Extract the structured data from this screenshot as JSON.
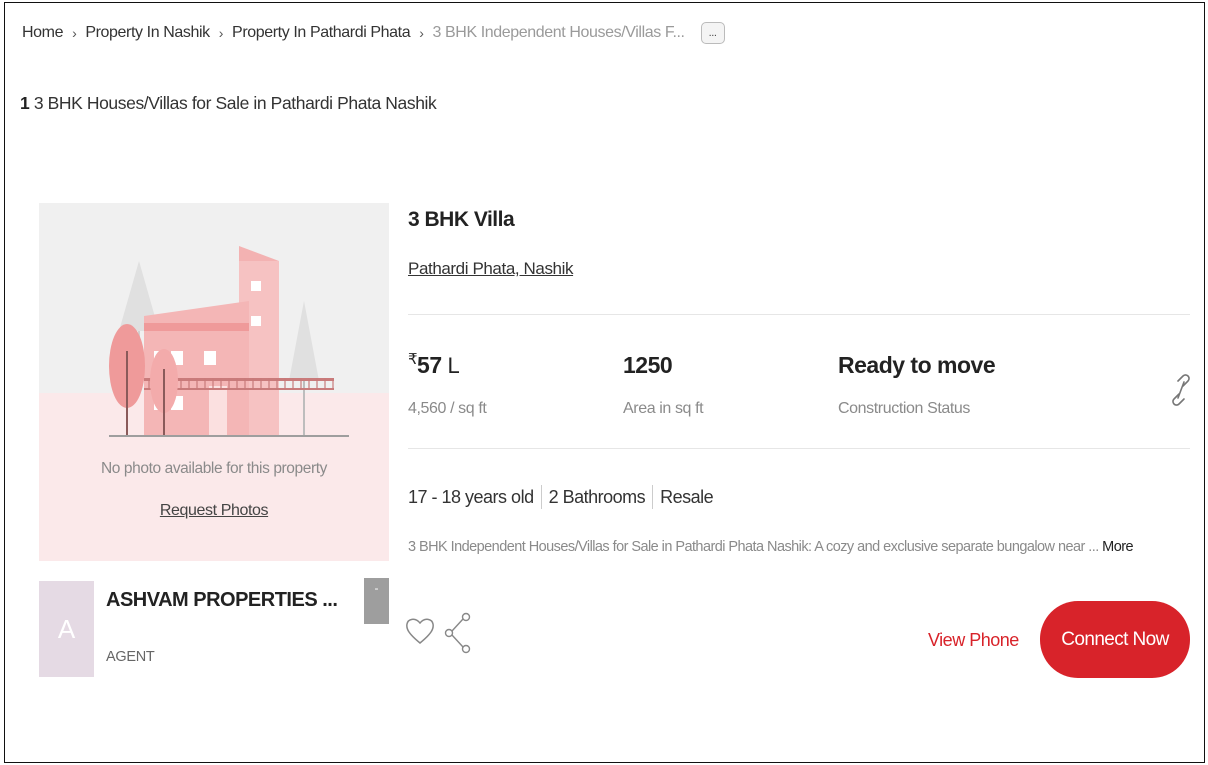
{
  "breadcrumb": {
    "items": [
      "Home",
      "Property In Nashik",
      "Property In Pathardi Phata"
    ],
    "current": "3 BHK Independent Houses/Villas F...",
    "more_label": "..."
  },
  "results": {
    "count": "1",
    "text": "3 BHK Houses/Villas for Sale in Pathardi Phata Nashik"
  },
  "listing": {
    "photo": {
      "no_photo_text": "No photo available for this property",
      "request_label": "Request Photos"
    },
    "agent": {
      "initial": "A",
      "name": "ASHVAM PROPERTIES ...",
      "role": "AGENT",
      "badge": "-"
    },
    "title": "3 BHK Villa",
    "locality": "Pathardi Phata, Nashik",
    "price": {
      "symbol": "₹",
      "amount": "57",
      "unit": "L",
      "per_sqft": "4,560 / sq ft"
    },
    "area": {
      "value": "1250",
      "label": "Area in sq ft"
    },
    "status": {
      "value": "Ready to move",
      "label": "Construction Status"
    },
    "features": [
      "17 - 18 years old",
      "2 Bathrooms",
      "Resale"
    ],
    "description": "3 BHK Independent Houses/Villas for Sale in Pathardi Phata Nashik: A cozy and exclusive separate bungalow near ...",
    "more_label": "More",
    "actions": {
      "view_phone": "View Phone",
      "connect_now": "Connect Now"
    }
  },
  "icons": [
    "link-icon",
    "heart-icon",
    "share-icon",
    "house-placeholder-illustration"
  ],
  "colors": {
    "accent": "#d8232a",
    "avatar_bg": "#e5dae4",
    "muted_text": "#8a8a8a"
  }
}
